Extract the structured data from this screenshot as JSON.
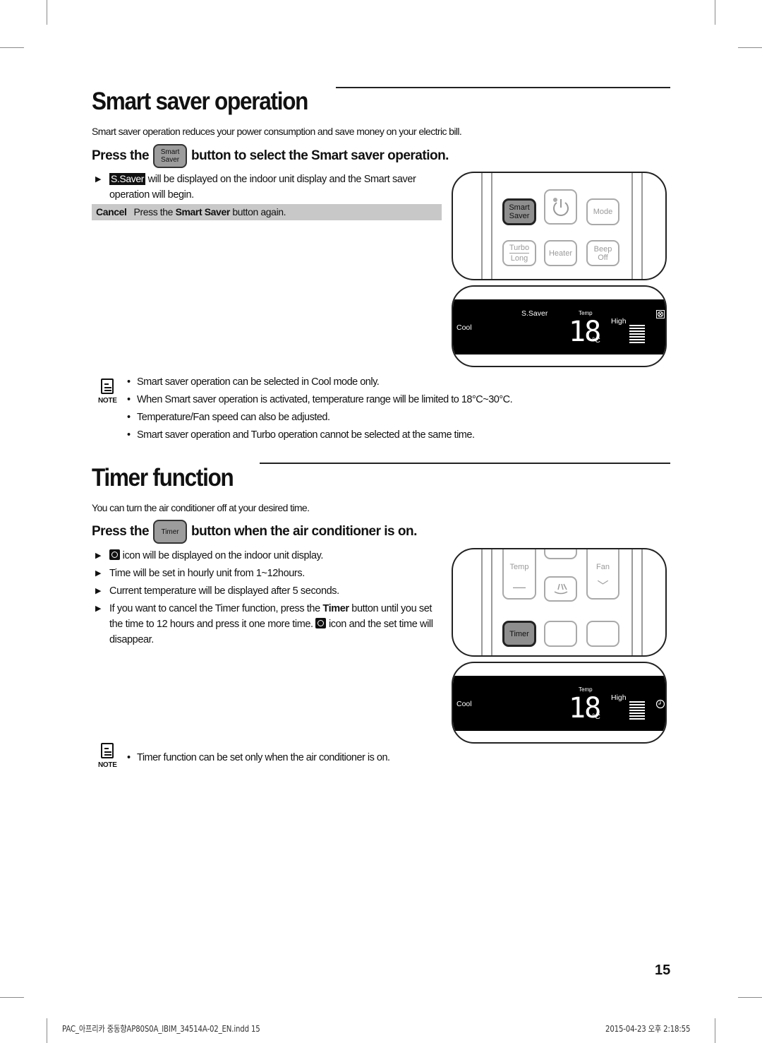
{
  "page": {
    "page_number": "15",
    "footer_left": "PAC_아프리카 중동향AP80S0A_IBIM_34514A-02_EN.indd   15",
    "footer_right": "2015-04-23   오후 2:18:55"
  },
  "smart_saver": {
    "title": "Smart saver operation",
    "intro": "Smart saver operation reduces your power consumption and save money on your electric bill.",
    "instruction_prefix": "Press the",
    "instruction_button": {
      "line1": "Smart",
      "line2": "Saver"
    },
    "instruction_suffix": "button to select the Smart saver operation.",
    "bullets": [
      {
        "chip": "S.Saver",
        "text": "will be displayed on the indoor unit display and the Smart saver operation will begin."
      }
    ],
    "cancel": {
      "label": "Cancel",
      "text_prefix": "Press the",
      "text_bold": "Smart Saver",
      "text_suffix": "button again."
    },
    "note_label": "NOTE",
    "notes": [
      "Smart saver operation can be selected in Cool mode only.",
      "When Smart saver operation is activated, temperature range will be limited to 18°C~30°C.",
      "Temperature/Fan speed can also be adjusted.",
      "Smart saver operation and Turbo operation cannot be selected at the same time."
    ],
    "remote": {
      "buttons": [
        {
          "line1": "Smart",
          "line2": "Saver",
          "active": true
        },
        {
          "icon": "power-icon"
        },
        {
          "line1": "Mode"
        },
        {
          "line1": "Turbo",
          "line2": "Long"
        },
        {
          "line1": "Heater"
        },
        {
          "line1": "Beep",
          "line2": "Off"
        }
      ]
    },
    "display": {
      "mode": "Cool",
      "indicator": "S.Saver",
      "temp_label": "Temp",
      "temperature": "18",
      "unit": "°C",
      "fan_label": "High",
      "fan_level_fraction": 1.0,
      "status_icon": "filter-icon"
    }
  },
  "timer": {
    "title": "Timer function",
    "intro": "You can turn the air conditioner off at your desired time.",
    "instruction_prefix": "Press the",
    "instruction_button": {
      "line1": "Timer"
    },
    "instruction_suffix": "button when the air conditioner is on.",
    "bullets": [
      {
        "icon": "clock-icon",
        "text": "icon will be displayed on the indoor unit display."
      },
      {
        "text": "Time will be set in hourly unit from 1~12hours."
      },
      {
        "text": "Current temperature will be displayed after 5 seconds."
      },
      {
        "text_prefix": "If you want to cancel the Timer function, press the",
        "text_bold": "Timer",
        "text_mid": "button until you set the time to 12 hours and press it one more time.",
        "text_suffix": "icon and the set time will disappear."
      }
    ],
    "note_label": "NOTE",
    "notes": [
      "Timer function can be set only when the air conditioner is on."
    ],
    "remote": {
      "buttons": [
        {
          "line1": "Temp",
          "line2": "—"
        },
        {
          "icon": "swing-icon"
        },
        {
          "line1": "Fan",
          "line2": "﹀"
        },
        {
          "line1": "Timer",
          "active": true
        },
        {
          "line1": ""
        },
        {
          "line1": ""
        }
      ]
    },
    "display": {
      "mode": "Cool",
      "temp_label": "Temp",
      "temperature": "18",
      "unit": "°C",
      "fan_label": "High",
      "fan_level_fraction": 1.0,
      "status_icon": "clock-icon"
    }
  }
}
